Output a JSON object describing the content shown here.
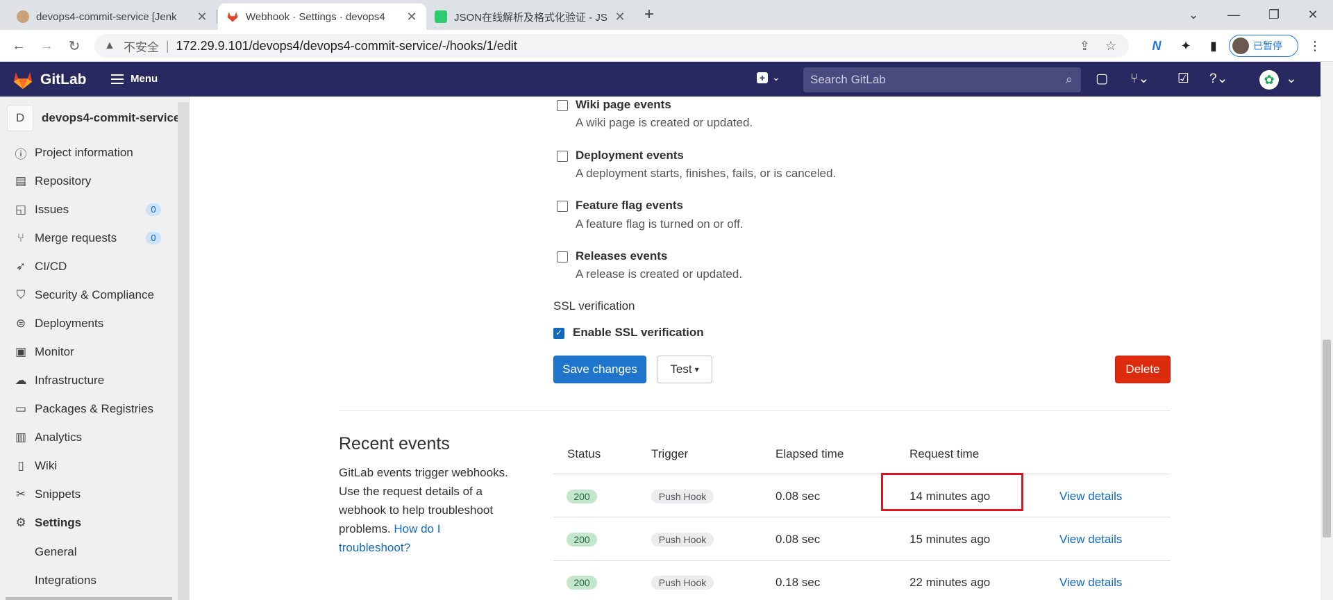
{
  "browser": {
    "tabs": [
      {
        "title": "devops4-commit-service [Jenk",
        "active": false
      },
      {
        "title": "Webhook · Settings · devops4",
        "active": true
      },
      {
        "title": "JSON在线解析及格式化验证 - JS",
        "active": false
      }
    ],
    "new_tab": "+",
    "security_label": "不安全",
    "url": "172.29.9.101/devops4/devops4-commit-service/-/hooks/1/edit",
    "profile_label": "已暂停"
  },
  "gitlab_nav": {
    "brand": "GitLab",
    "menu_label": "Menu",
    "search_placeholder": "Search GitLab"
  },
  "sidebar": {
    "project_initial": "D",
    "project_name": "devops4-commit-service",
    "items": [
      {
        "label": "Project information",
        "icon": "info-icon"
      },
      {
        "label": "Repository",
        "icon": "document-icon"
      },
      {
        "label": "Issues",
        "icon": "issues-icon",
        "count": "0"
      },
      {
        "label": "Merge requests",
        "icon": "merge-request-icon",
        "count": "0"
      },
      {
        "label": "CI/CD",
        "icon": "rocket-icon"
      },
      {
        "label": "Security & Compliance",
        "icon": "shield-icon"
      },
      {
        "label": "Deployments",
        "icon": "deployments-icon"
      },
      {
        "label": "Monitor",
        "icon": "monitor-icon"
      },
      {
        "label": "Infrastructure",
        "icon": "cloud-icon"
      },
      {
        "label": "Packages & Registries",
        "icon": "package-icon"
      },
      {
        "label": "Analytics",
        "icon": "chart-icon"
      },
      {
        "label": "Wiki",
        "icon": "book-icon"
      },
      {
        "label": "Snippets",
        "icon": "scissors-icon"
      },
      {
        "label": "Settings",
        "icon": "gear-icon"
      }
    ],
    "sub_items": [
      {
        "label": "General"
      },
      {
        "label": "Integrations"
      }
    ]
  },
  "events": [
    {
      "title": "Wiki page events",
      "desc": "A wiki page is created or updated.",
      "checked": false
    },
    {
      "title": "Deployment events",
      "desc": "A deployment starts, finishes, fails, or is canceled.",
      "checked": false
    },
    {
      "title": "Feature flag events",
      "desc": "A feature flag is turned on or off.",
      "checked": false
    },
    {
      "title": "Releases events",
      "desc": "A release is created or updated.",
      "checked": false
    }
  ],
  "ssl": {
    "heading": "SSL verification",
    "label": "Enable SSL verification",
    "checked": true
  },
  "buttons": {
    "save": "Save changes",
    "test": "Test",
    "delete": "Delete"
  },
  "recent": {
    "title": "Recent events",
    "desc": "GitLab events trigger webhooks. Use the request details of a webhook to help troubleshoot problems.",
    "help_link": "How do I troubleshoot?",
    "columns": [
      "Status",
      "Trigger",
      "Elapsed time",
      "Request time"
    ],
    "rows": [
      {
        "status": "200",
        "trigger": "Push Hook",
        "elapsed": "0.08 sec",
        "request_time": "14 minutes ago",
        "action": "View details"
      },
      {
        "status": "200",
        "trigger": "Push Hook",
        "elapsed": "0.08 sec",
        "request_time": "15 minutes ago",
        "action": "View details"
      },
      {
        "status": "200",
        "trigger": "Push Hook",
        "elapsed": "0.18 sec",
        "request_time": "22 minutes ago",
        "action": "View details"
      }
    ]
  },
  "colors": {
    "gitlab_nav": "#292961",
    "primary": "#1f75cb",
    "danger": "#dd2b0e",
    "success_badge": "#c3e6cd",
    "highlight_box": "#e0141e"
  }
}
